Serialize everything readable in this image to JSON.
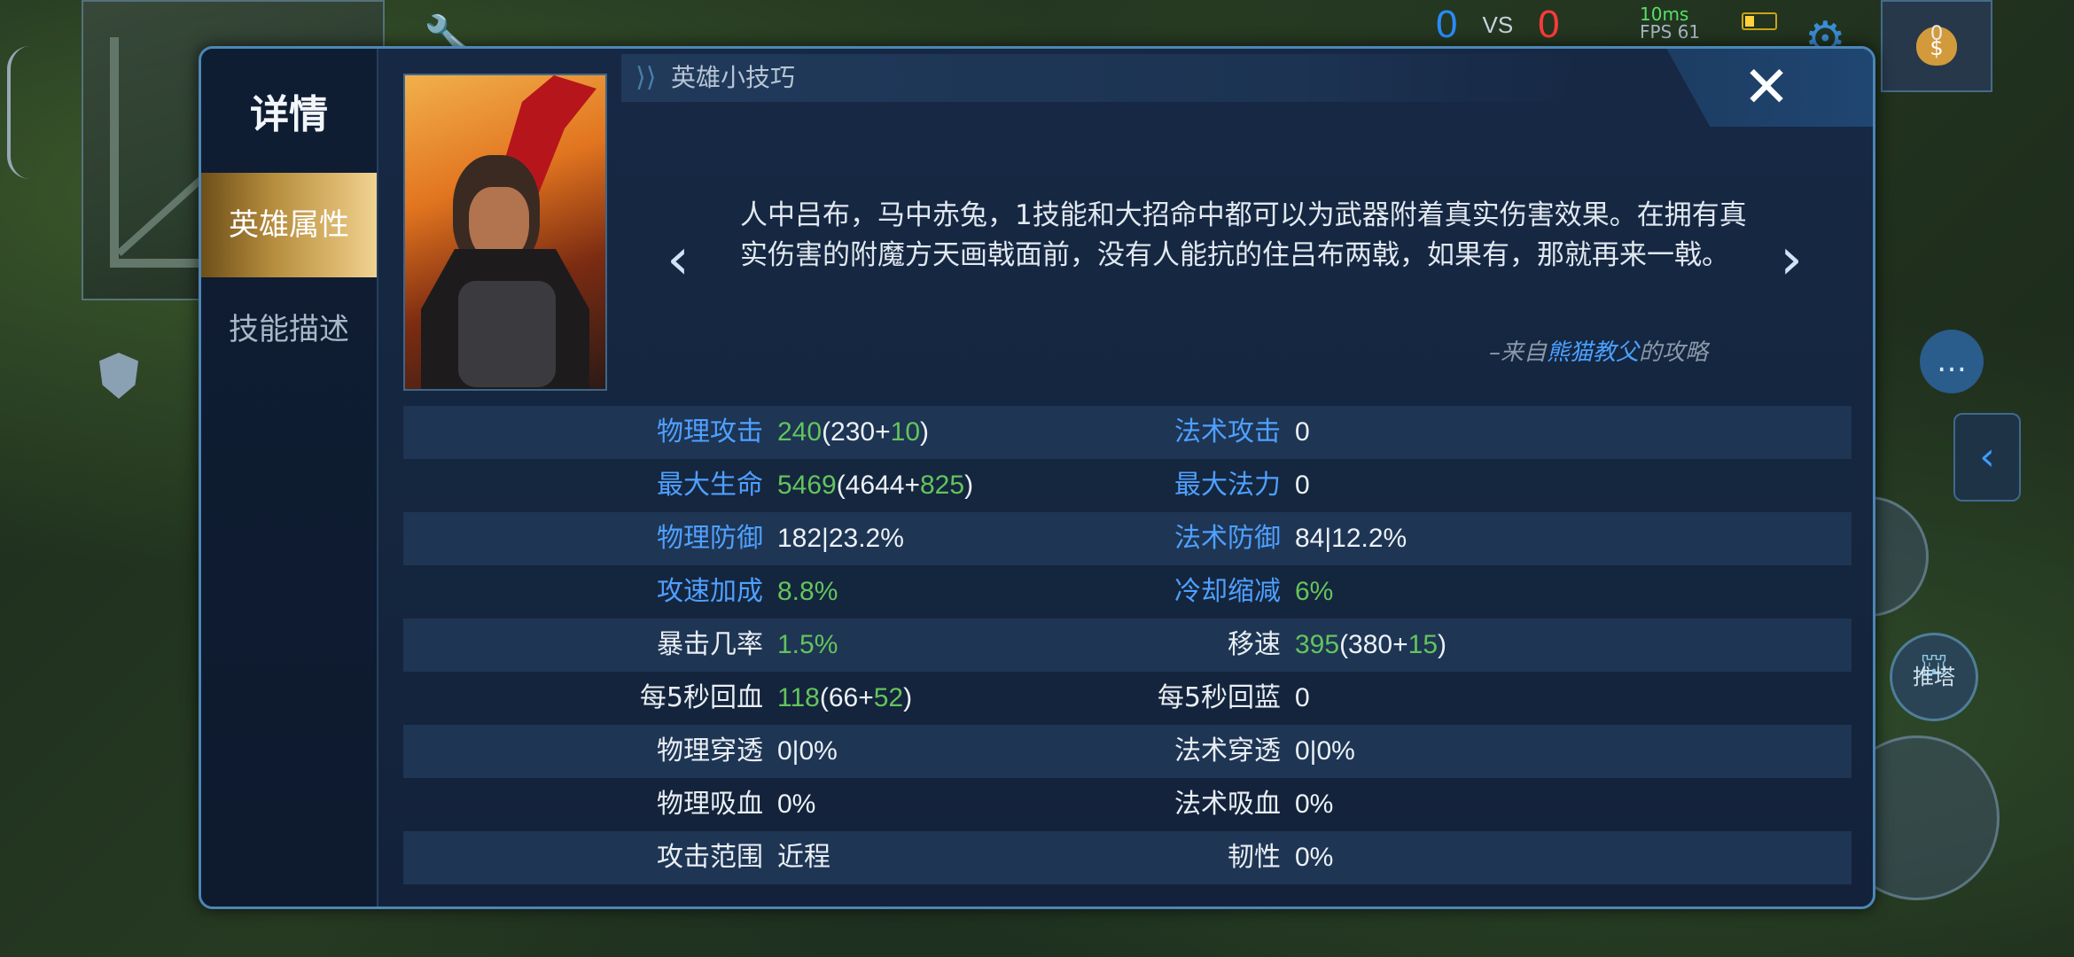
{
  "hud": {
    "score_blue": "0",
    "score_vs": "VS",
    "score_red": "0",
    "ping": "10ms",
    "fps": "FPS 61",
    "gold": "0",
    "push_label": "推塔"
  },
  "dialog": {
    "title": "详情",
    "nav": [
      "英雄属性",
      "技能描述"
    ],
    "tips_header": "英雄小技巧",
    "close_label": "✕",
    "tip_text": "人中吕布，马中赤兔，1技能和大招命中都可以为武器附着真实伤害效果。在拥有真实伤害的附魔方天画戟面前，没有人能抗的住吕布两戟，如果有，那就再来一戟。",
    "tip_source_prefix": "–来自",
    "tip_source_author": "熊猫教父",
    "tip_source_suffix": "的攻略"
  },
  "stats": [
    {
      "left_label": "物理攻击",
      "left_color": "blue",
      "left_value": [
        {
          "t": "240",
          "g": true
        },
        {
          "t": "(230+"
        },
        {
          "t": "10",
          "g": true
        },
        {
          "t": ")"
        }
      ],
      "right_label": "法术攻击",
      "right_color": "blue",
      "right_value": [
        {
          "t": "0"
        }
      ]
    },
    {
      "left_label": "最大生命",
      "left_color": "blue",
      "left_value": [
        {
          "t": "5469",
          "g": true
        },
        {
          "t": "(4644+"
        },
        {
          "t": "825",
          "g": true
        },
        {
          "t": ")"
        }
      ],
      "right_label": "最大法力",
      "right_color": "blue",
      "right_value": [
        {
          "t": "0"
        }
      ]
    },
    {
      "left_label": "物理防御",
      "left_color": "blue",
      "left_value": [
        {
          "t": "182|23.2%"
        }
      ],
      "right_label": "法术防御",
      "right_color": "blue",
      "right_value": [
        {
          "t": "84|12.2%"
        }
      ]
    },
    {
      "left_label": "攻速加成",
      "left_color": "blue",
      "left_value": [
        {
          "t": "8.8%",
          "g": true
        }
      ],
      "right_label": "冷却缩减",
      "right_color": "blue",
      "right_value": [
        {
          "t": "6%",
          "g": true
        }
      ]
    },
    {
      "left_label": "暴击几率",
      "left_color": "white",
      "left_value": [
        {
          "t": "1.5%",
          "g": true
        }
      ],
      "right_label": "移速",
      "right_color": "white",
      "right_value": [
        {
          "t": "395",
          "g": true
        },
        {
          "t": "(380+"
        },
        {
          "t": "15",
          "g": true
        },
        {
          "t": ")"
        }
      ]
    },
    {
      "left_label": "每5秒回血",
      "left_color": "white",
      "left_value": [
        {
          "t": "118",
          "g": true
        },
        {
          "t": "(66+"
        },
        {
          "t": "52",
          "g": true
        },
        {
          "t": ")"
        }
      ],
      "right_label": "每5秒回蓝",
      "right_color": "white",
      "right_value": [
        {
          "t": "0"
        }
      ]
    },
    {
      "left_label": "物理穿透",
      "left_color": "white",
      "left_value": [
        {
          "t": "0|0%"
        }
      ],
      "right_label": "法术穿透",
      "right_color": "white",
      "right_value": [
        {
          "t": "0|0%"
        }
      ]
    },
    {
      "left_label": "物理吸血",
      "left_color": "white",
      "left_value": [
        {
          "t": "0%"
        }
      ],
      "right_label": "法术吸血",
      "right_color": "white",
      "right_value": [
        {
          "t": "0%"
        }
      ]
    },
    {
      "left_label": "攻击范围",
      "left_color": "white",
      "left_value": [
        {
          "t": "近程"
        }
      ],
      "right_label": "韧性",
      "right_color": "white",
      "right_value": [
        {
          "t": "0%"
        }
      ]
    }
  ],
  "colors": {
    "stat_blue": "#4fa0ff",
    "stat_green": "#63c45c",
    "nav_active": "#b58c3d",
    "dialog_border": "#4d86b6"
  },
  "icons": [
    "wrench-icon",
    "gear-icon",
    "money-bag-icon",
    "chat-icon",
    "back-arrow-icon",
    "shield-icon",
    "close-icon",
    "prev-arrow-icon",
    "next-arrow-icon"
  ]
}
